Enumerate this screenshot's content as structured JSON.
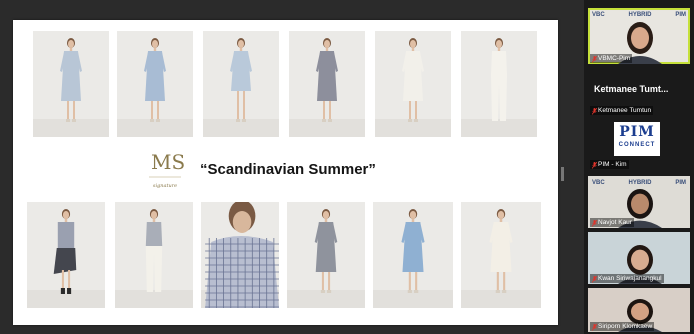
{
  "slide": {
    "brand_logo_letters": "MS",
    "brand_logo_sub": "signature",
    "collection_title": "“Scandinavian Summer”",
    "top_row_photos": [
      {
        "name": "photo-light-blue-dress",
        "color": "#b8c6d6",
        "style": "dress"
      },
      {
        "name": "photo-blue-asymmetric-dress",
        "color": "#a8bcd4",
        "style": "dress"
      },
      {
        "name": "photo-blue-wrap-dress",
        "color": "#b9c9da",
        "style": "short"
      },
      {
        "name": "photo-grey-gingham-dress",
        "color": "#8d8f9c",
        "style": "dress"
      },
      {
        "name": "photo-white-sleeveless-dress",
        "color": "#f2f0ea",
        "style": "dress"
      },
      {
        "name": "photo-white-jumpsuit",
        "color": "#f4f2ec",
        "style": "pants"
      }
    ],
    "bottom_row_photos": [
      {
        "name": "photo-grey-top-skirt",
        "color": "#9aa0b0",
        "style": "skirt"
      },
      {
        "name": "photo-grey-top-white-pants",
        "color": "#a9aeb8",
        "style": "pants"
      },
      {
        "name": "photo-checked-top-closeup",
        "color": "#b8bed0",
        "style": "closeup"
      },
      {
        "name": "photo-grey-beige-dress",
        "color": "#8f939d",
        "style": "dress"
      },
      {
        "name": "photo-blue-patchwork-dress",
        "color": "#8fb0d2",
        "style": "dress"
      },
      {
        "name": "photo-white-slip-dress",
        "color": "#f3efe6",
        "style": "dress"
      }
    ]
  },
  "gallery": {
    "tiles": [
      {
        "name": "VBMC-Pim",
        "active": true,
        "muted": true,
        "kind": "camera",
        "skin": "#d9a98c",
        "hair": "#2a1d16",
        "bg": "#e8e6e0",
        "logos": [
          "VBC",
          "HYBRID",
          "PIM"
        ]
      },
      {
        "name": "Ketmanee Tumtun",
        "display_name": "Ketmanee  Tumt...",
        "muted": true,
        "kind": "name"
      },
      {
        "name": "PIM - Kim",
        "muted": true,
        "kind": "logo",
        "logo_main": "PIM",
        "logo_sub": "CONNECT"
      },
      {
        "name": "Navjot Kaur",
        "muted": true,
        "kind": "camera",
        "skin": "#b98a6c",
        "hair": "#1a1412",
        "bg": "#dedcd6",
        "logos": [
          "VBC",
          "HYBRID",
          "PIM"
        ]
      },
      {
        "name": "Kwan Siriwajanangkul",
        "muted": true,
        "kind": "camera",
        "skin": "#d8ac90",
        "hair": "#221712",
        "bg": "#c9d4d8",
        "logos": []
      },
      {
        "name": "Siriporn Klomkaew",
        "display_name": "Siri...",
        "muted": true,
        "kind": "camera",
        "skin": "#d3a183",
        "hair": "#1c1410",
        "bg": "#d8cfc7",
        "logos": []
      }
    ]
  },
  "colors": {
    "active_speaker": "#c5e03a",
    "muted_mic": "#e0342b"
  }
}
